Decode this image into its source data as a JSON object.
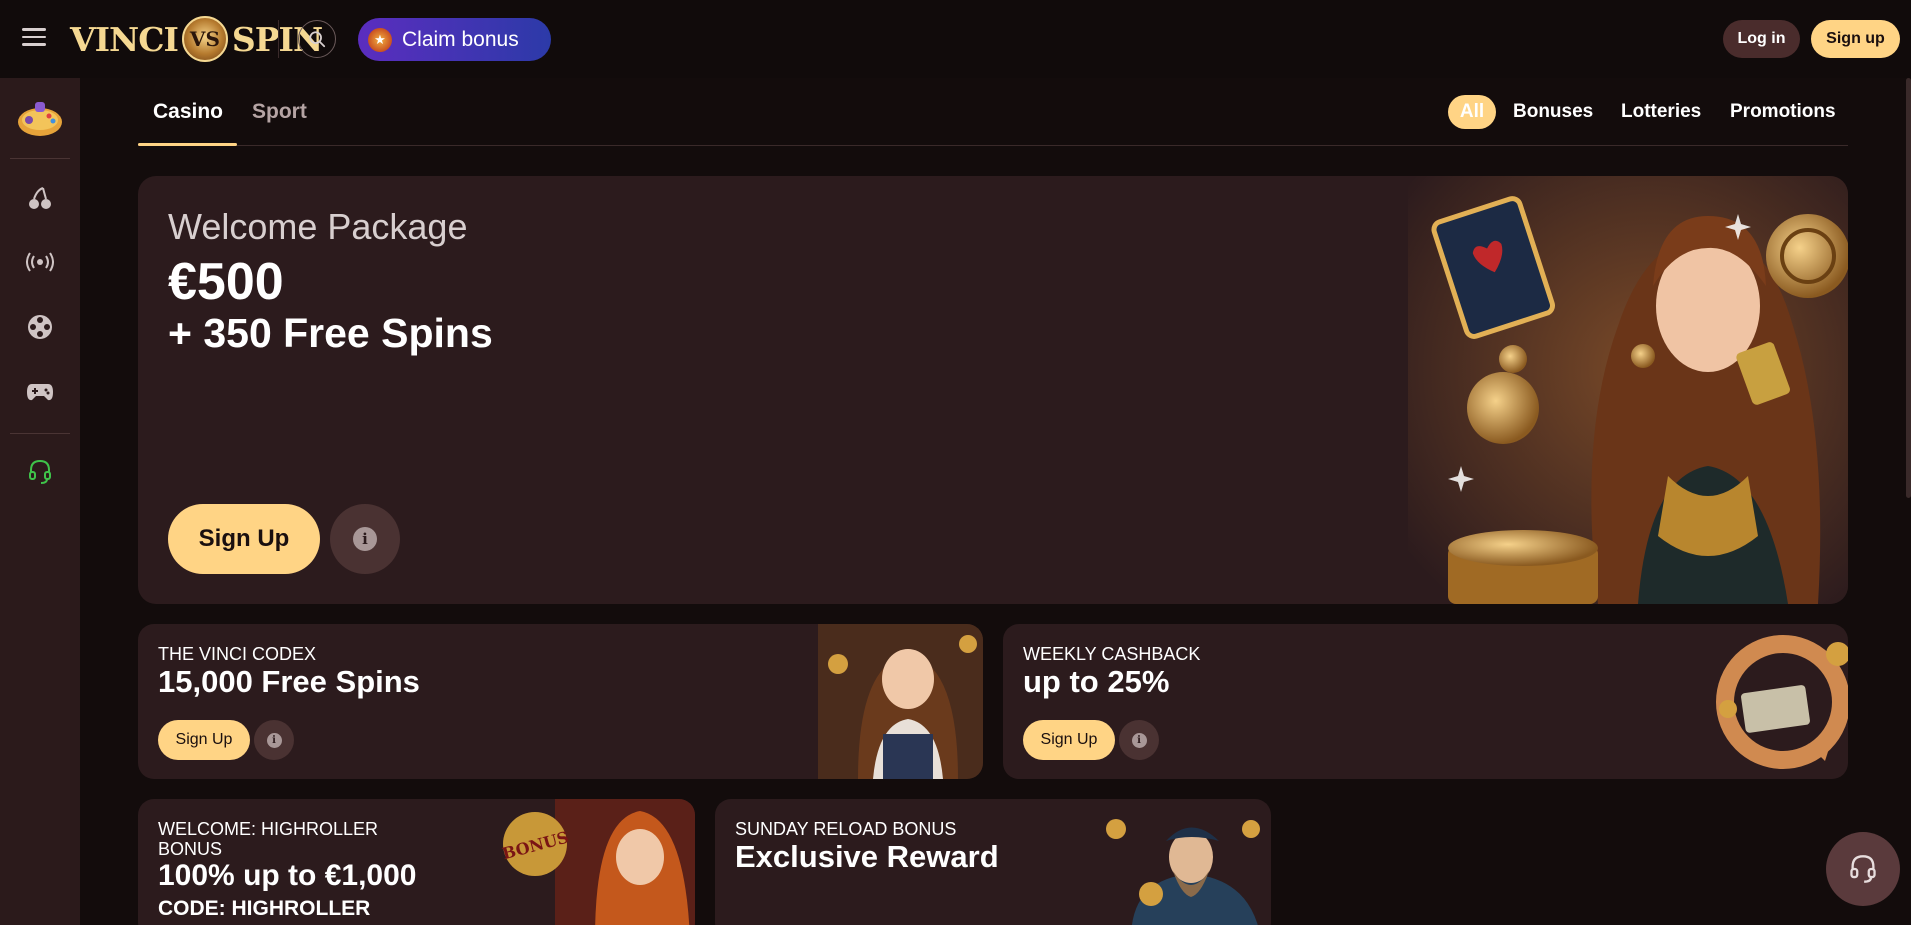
{
  "header": {
    "logo_left": "VINCI",
    "logo_mark": "VS",
    "logo_right": "SPIN",
    "claim_label": "Claim bonus",
    "login_label": "Log in",
    "signup_label": "Sign up"
  },
  "sidebar": {
    "items": [
      {
        "icon": "gamepad-avatar-icon"
      },
      {
        "icon": "cherry-icon"
      },
      {
        "icon": "live-broadcast-icon"
      },
      {
        "icon": "film-reel-icon"
      },
      {
        "icon": "gamepad-icon"
      },
      {
        "icon": "headset-icon"
      }
    ]
  },
  "tabs": {
    "casino": "Casino",
    "sport": "Sport"
  },
  "filters": {
    "all": "All",
    "bonuses": "Bonuses",
    "lotteries": "Lotteries",
    "promotions": "Promotions"
  },
  "hero": {
    "subtitle": "Welcome Package",
    "amount": "€500",
    "spins": "+ 350 Free Spins",
    "signup_label": "Sign Up",
    "info_icon": "i"
  },
  "cards": [
    {
      "kicker": "THE VINCI CODEX",
      "title": "15,000 Free Spins",
      "signup_label": "Sign Up",
      "art": "codex-girl"
    },
    {
      "kicker": "WEEKLY CASHBACK",
      "title": "up to 25%",
      "signup_label": "Sign Up",
      "art": "cashback-coins"
    },
    {
      "kicker": "WELCOME: HIGHROLLER BONUS",
      "title": "100% up to €1,000",
      "code": "CODE: HIGHROLLER",
      "art": "bonus-girl"
    },
    {
      "kicker": "SUNDAY RELOAD BONUS",
      "title": "Exclusive Reward",
      "art": "captain"
    }
  ],
  "colors": {
    "accent": "#ffd485",
    "background": "#130c0c",
    "card": "#2c1b1d",
    "sidebar": "#2b1a1b",
    "claim_gradient_start": "#5b2dbf",
    "claim_gradient_end": "#2c3aa8",
    "support_green": "#3fc24a"
  }
}
